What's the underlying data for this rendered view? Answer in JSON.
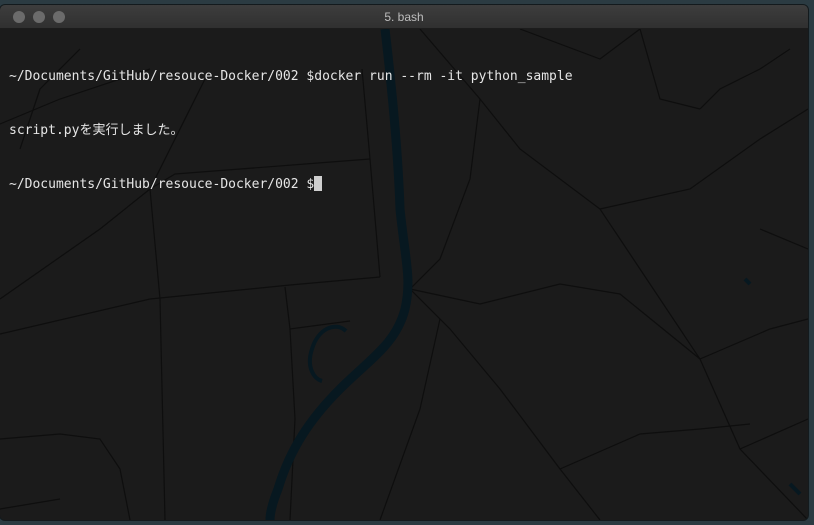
{
  "window": {
    "title": "5. bash"
  },
  "terminal": {
    "lines": [
      {
        "prompt": "~/Documents/GitHub/resouce-Docker/002 $",
        "command": "docker run --rm -it python_sample"
      },
      {
        "output": "script.pyを実行しました。"
      },
      {
        "prompt": "~/Documents/GitHub/resouce-Docker/002 $",
        "command": ""
      }
    ]
  },
  "colors": {
    "window_bg": "#1b1b1b",
    "titlebar": "#353535",
    "text": "#e6e6e6",
    "map_lines": "#0d0d0d",
    "river": "#0a1a22",
    "desktop": "#2b3b42"
  }
}
